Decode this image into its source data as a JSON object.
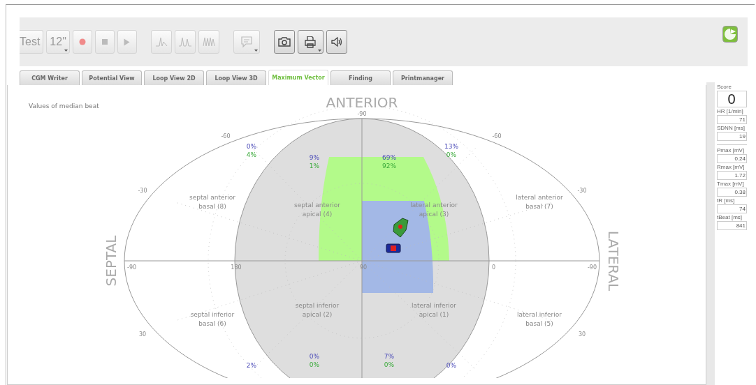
{
  "toolbar": {
    "buttons": [
      {
        "kind": "text",
        "label": "Test",
        "disabled": true
      },
      {
        "kind": "dropdown",
        "label": "12\"",
        "disabled": true
      },
      {
        "kind": "record",
        "disabled": true
      },
      {
        "kind": "stop",
        "disabled": true
      },
      {
        "kind": "play",
        "disabled": true
      },
      {
        "kind": "wave-single",
        "disabled": true
      },
      {
        "kind": "wave-double",
        "disabled": true
      },
      {
        "kind": "wave-multi",
        "disabled": true
      },
      {
        "kind": "comment",
        "disabled": true
      },
      {
        "kind": "camera",
        "disabled": false
      },
      {
        "kind": "printer",
        "disabled": false
      },
      {
        "kind": "speaker",
        "disabled": false
      }
    ]
  },
  "tabs": [
    {
      "label": "CGM Writer",
      "selected": false
    },
    {
      "label": "Potential View",
      "selected": false
    },
    {
      "label": "Loop View 2D",
      "selected": false
    },
    {
      "label": "Loop View 3D",
      "selected": false
    },
    {
      "label": "Maximum Vector",
      "selected": true
    },
    {
      "label": "Finding",
      "selected": false
    },
    {
      "label": "Printmanager",
      "selected": false
    }
  ],
  "chart": {
    "caption": "Values of median beat",
    "top_label": "ANTERIOR",
    "left_label": "SEPTAL",
    "right_label": "LATERAL",
    "ticks": [
      "-90",
      "-60",
      "-60",
      "-30",
      "-30",
      "-90",
      "180",
      "90",
      "0",
      "-90",
      "30",
      "30"
    ],
    "regions": [
      [
        "septal anterior",
        "basal (8)"
      ],
      [
        "septal anterior",
        "apical (4)"
      ],
      [
        "lateral anterior",
        "apical (3)"
      ],
      [
        "lateral anterior",
        "basal (7)"
      ],
      [
        "septal inferior",
        "basal (6)"
      ],
      [
        "septal inferior",
        "apical (2)"
      ],
      [
        "lateral inferior",
        "apical (1)"
      ],
      [
        "lateral inferior",
        "basal (5)"
      ]
    ],
    "percentages": [
      {
        "first": "0%",
        "second": "4%"
      },
      {
        "first": "9%",
        "second": "1%"
      },
      {
        "first": "69%",
        "second": "92%"
      },
      {
        "first": "13%",
        "second": "0%"
      },
      {
        "first": "2%"
      },
      {
        "first": "0%",
        "second": "0%"
      },
      {
        "first": "7%",
        "second": "0%"
      },
      {
        "first": "0%"
      }
    ]
  },
  "side_panel": {
    "groups": [
      [
        {
          "kind": "score",
          "label": "Score",
          "value": "0"
        },
        {
          "kind": "metric",
          "label": "HR [1/min]",
          "value": "71"
        },
        {
          "kind": "metric",
          "label": "SDNN [ms]",
          "value": "19"
        }
      ],
      [
        {
          "kind": "metric",
          "label": "Pmax [mV]",
          "value": "0.24"
        },
        {
          "kind": "metric",
          "label": "Rmax [mV]",
          "value": "1.72"
        },
        {
          "kind": "metric",
          "label": "Tmax [mV]",
          "value": "0.38"
        },
        {
          "kind": "metric",
          "label": "tR [ms]",
          "value": "74"
        },
        {
          "kind": "metric",
          "label": "tBeat [ms]",
          "value": "841"
        }
      ]
    ]
  }
}
